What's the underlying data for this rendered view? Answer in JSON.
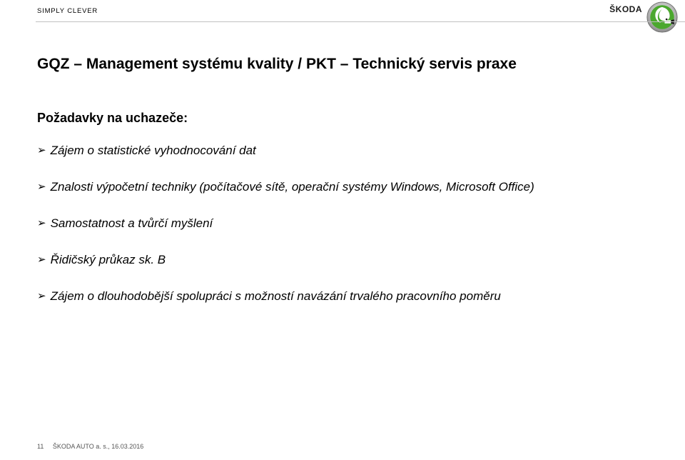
{
  "header": {
    "tagline": "SIMPLY CLEVER",
    "brand": "ŠKODA"
  },
  "title": "GQZ – Management systému kvality / PKT – Technický servis praxe",
  "section_heading": "Požadavky na uchazeče:",
  "bullets": [
    "Zájem o statistické vyhodnocování dat",
    "Znalosti výpočetní techniky (počítačové sítě, operační systémy Windows, Microsoft Office)",
    "Samostatnost a tvůrčí myšlení",
    "Řidičský průkaz sk. B",
    "Zájem o dlouhodobější spolupráci s možností navázání trvalého pracovního poměru"
  ],
  "footer": {
    "page_number": "11",
    "org_line": "ŠKODA AUTO a. s., 16.03.2016"
  }
}
